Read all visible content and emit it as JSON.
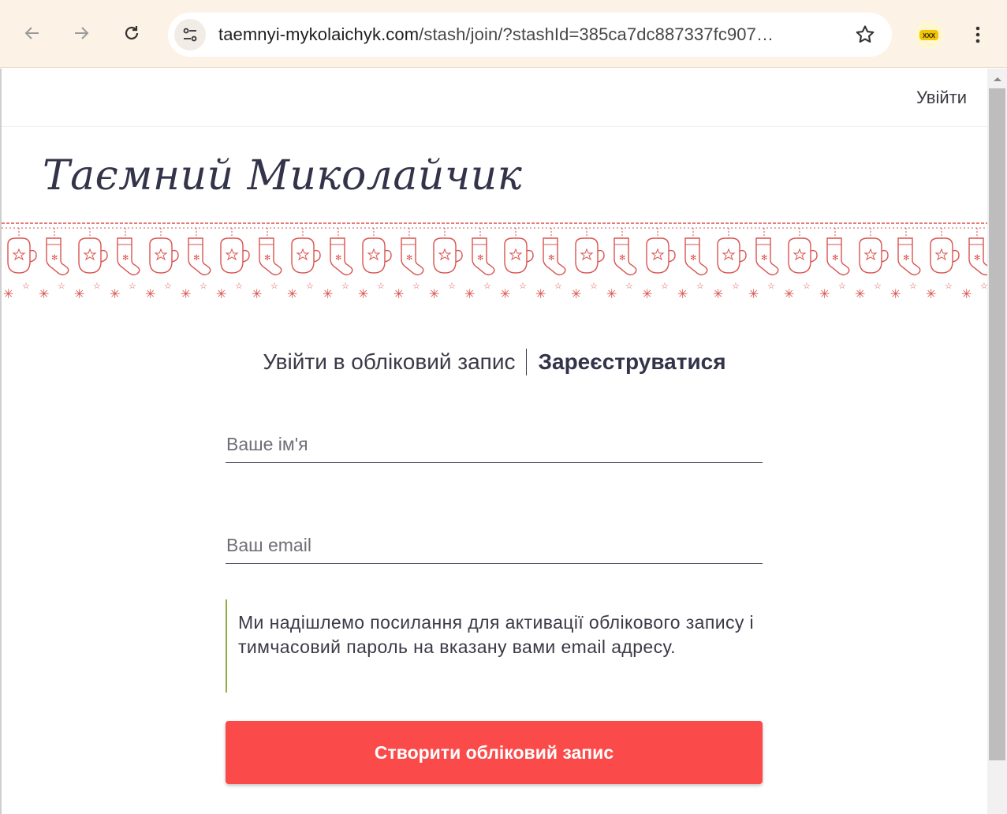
{
  "browser": {
    "url_domain": "taemnyi-mykolaichyk.com",
    "url_path": "/stash/join/?stashId=385ca7dc887337fc907…",
    "extension_label": "XXX"
  },
  "header": {
    "login_link": "Увійти",
    "site_title": "Таємний Миколайчик"
  },
  "tabs": {
    "login": "Увійти в обліковий запис",
    "register": "Зареєструватися"
  },
  "form": {
    "name_placeholder": "Ваше ім'я",
    "email_placeholder": "Ваш email",
    "notice": "Ми надішлемо посилання для активації облікового запису і тимчасовий пароль на вказану вами email адресу.",
    "submit_label": "Створити обліковий запис"
  },
  "colors": {
    "accent": "#fb4a4a",
    "ornament": "#d9534f",
    "notice_border": "#8fae3e",
    "title": "#33334a"
  }
}
